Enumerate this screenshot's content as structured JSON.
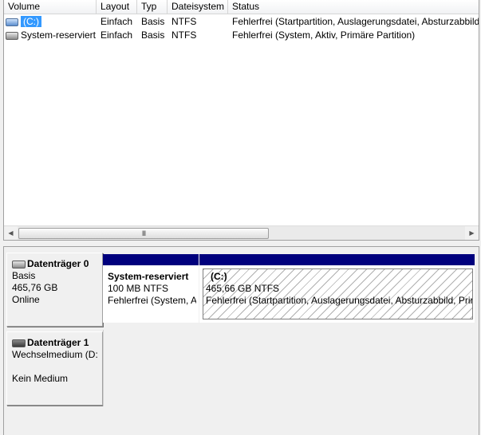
{
  "columns": {
    "volume": "Volume",
    "layout": "Layout",
    "typ": "Typ",
    "dateisystem": "Dateisystem",
    "status": "Status"
  },
  "volumes": [
    {
      "name": "(C:)",
      "layout": "Einfach",
      "typ": "Basis",
      "fs": "NTFS",
      "status": "Fehlerfrei (Startpartition, Auslagerungsdatei, Absturzabbild"
    },
    {
      "name": "System-reserviert",
      "layout": "Einfach",
      "typ": "Basis",
      "fs": "NTFS",
      "status": "Fehlerfrei (System, Aktiv, Primäre Partition)"
    }
  ],
  "scrollbar": {
    "thumb_glyph": "III"
  },
  "disks": [
    {
      "title": "Datenträger 0",
      "type": "Basis",
      "size": "465,76 GB",
      "state": "Online",
      "partitions": [
        {
          "name": "System-reserviert",
          "size": "100 MB NTFS",
          "status": "Fehlerfrei (System, A"
        },
        {
          "name": "(C:)",
          "size": "465,66 GB NTFS",
          "status": "Fehlerfrei (Startpartition, Auslagerungsdatei, Absturzabbild, Prir"
        }
      ]
    },
    {
      "title": "Datenträger 1",
      "type": "Wechselmedium (D:",
      "size": "",
      "state": "Kein Medium"
    }
  ],
  "colors": {
    "partition_bar": "#00007d",
    "selection": "#3399ff"
  }
}
